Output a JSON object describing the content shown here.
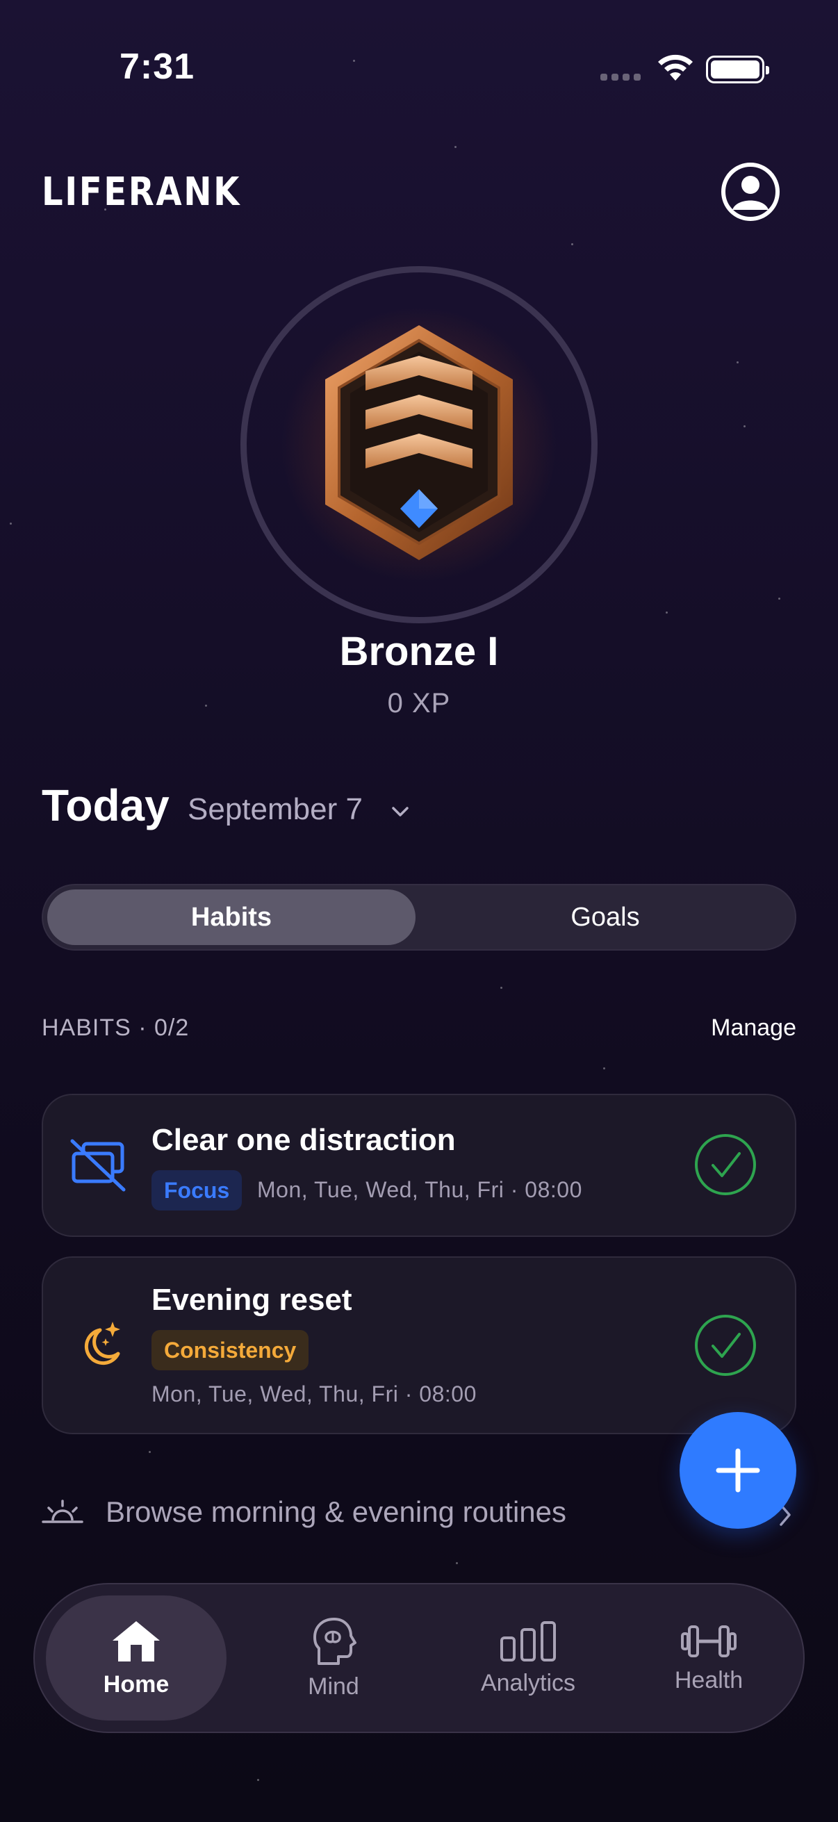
{
  "status_bar": {
    "time": "7:31"
  },
  "header": {
    "logo": "LIFERANK",
    "profile_icon": "user-circle-icon"
  },
  "rank": {
    "name": "Bronze I",
    "xp": "0 XP",
    "badge_icon": "bronze-rank-badge-icon"
  },
  "today": {
    "title": "Today",
    "date": "September 7"
  },
  "segments": {
    "habits": "Habits",
    "goals": "Goals",
    "selected": "Habits"
  },
  "habits_section": {
    "label": "HABITS · 0/2",
    "manage": "Manage"
  },
  "habits": [
    {
      "title": "Clear one distraction",
      "tag": "Focus",
      "schedule": "Mon, Tue, Wed, Thu, Fri · 08:00",
      "icon": "no-screens-icon",
      "accent": "#3a7bff"
    },
    {
      "title": "Evening reset",
      "tag": "Consistency",
      "schedule": "Mon, Tue, Wed, Thu, Fri · 08:00",
      "icon": "moon-stars-icon",
      "accent": "#f4aa3a"
    }
  ],
  "routines_link": {
    "label": "Browse morning & evening routines",
    "icon": "sunrise-icon"
  },
  "fab": {
    "icon": "plus-icon",
    "color": "#2f7bff"
  },
  "tabbar": {
    "home": "Home",
    "mind": "Mind",
    "analytics": "Analytics",
    "health": "Health",
    "active": "Home"
  },
  "colors": {
    "check_green": "#2ea44f",
    "background": "#150e28"
  }
}
